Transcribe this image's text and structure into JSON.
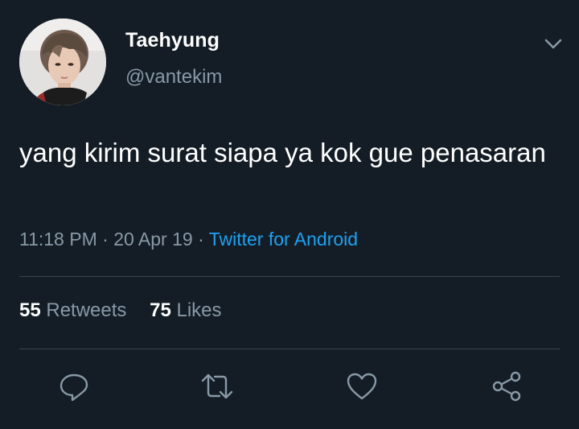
{
  "tweet": {
    "author": {
      "display_name": "Taehyung",
      "handle": "@vantekim",
      "avatar_icon": "profile-photo"
    },
    "text": "yang kirim surat siapa ya kok gue penasaran",
    "time": "11:18 PM",
    "separator": "·",
    "date": "20 Apr 19",
    "source": "Twitter for Android",
    "stats": {
      "retweets_count": "55",
      "retweets_label": "Retweets",
      "likes_count": "75",
      "likes_label": "Likes"
    },
    "actions": [
      {
        "name": "reply",
        "icon": "speech-bubble-icon"
      },
      {
        "name": "retweet",
        "icon": "retweet-arrows-icon"
      },
      {
        "name": "like",
        "icon": "heart-icon"
      },
      {
        "name": "share",
        "icon": "share-nodes-icon"
      }
    ]
  },
  "colors": {
    "background": "#141d26",
    "text_primary": "#ffffff",
    "text_secondary": "#8899a6",
    "link": "#1da1f2",
    "divider": "#38444d"
  }
}
